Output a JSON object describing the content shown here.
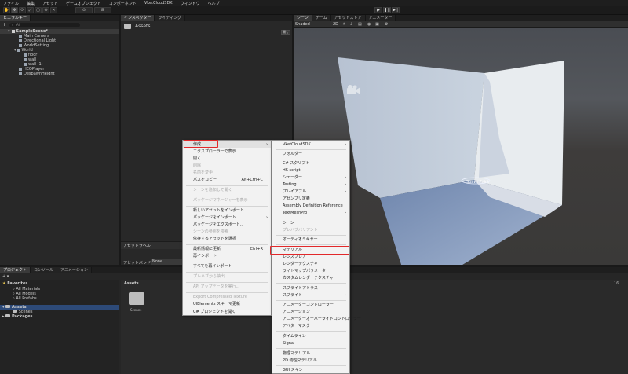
{
  "menubar": [
    "ファイル",
    "編集",
    "アセット",
    "ゲームオブジェクト",
    "コンポーネント",
    "VketCloudSDK",
    "ウィンドウ",
    "ヘルプ"
  ],
  "hierarchy": {
    "tab": "ヒエラルキー",
    "add": "+",
    "search_text": "All",
    "rows": [
      "SampleScene*",
      "Main Camera",
      "Directional Light",
      "WorldSetting",
      "World",
      "floor",
      "wall",
      "wall (1)",
      "HEOPlayer",
      "DespawnHeight"
    ]
  },
  "inspector": {
    "tabs": [
      "インスペクター",
      "ライティング"
    ],
    "header": "Assets",
    "open_btn": "開く",
    "asset_label_title": "アセットラベル",
    "asset_bundle_label": "アセットバンドル",
    "asset_bundle_value": "None"
  },
  "scene": {
    "tabs": [
      "シーン",
      "ゲーム",
      "アセットストア",
      "アニメーター"
    ],
    "shading": "Shaded",
    "mode2d": "2D",
    "spawn_label": "SpawnPoint"
  },
  "project": {
    "tabs": [
      "プロジェクト",
      "コンソール",
      "アニメーション"
    ],
    "favorites": "Favorites",
    "fav_items": [
      "All Materials",
      "All Models",
      "All Prefabs"
    ],
    "assets": "Assets",
    "scenes": "Scenes",
    "packages": "Packages",
    "assets_header": "Assets",
    "folder_label": "Scenes",
    "count": "16"
  },
  "context_menu": {
    "items": [
      {
        "label": "作成",
        "submenu": true,
        "highlight": true
      },
      {
        "label": "エクスプローラーで表示"
      },
      {
        "label": "開く"
      },
      {
        "label": "削除",
        "disabled": true
      },
      {
        "label": "名前を変更",
        "disabled": true
      },
      {
        "label": "パスをコピー",
        "shortcut": "Alt+Ctrl+C"
      },
      {
        "label": "シーンを追加して開く",
        "disabled": true
      },
      {
        "label": "パッケージマネージャーを表示",
        "disabled": true
      },
      {
        "label": "新しいアセットをインポート..."
      },
      {
        "label": "パッケージをインポート",
        "submenu": true
      },
      {
        "label": "パッケージをエクスポート..."
      },
      {
        "label": "シーンの参照を検索",
        "disabled": true
      },
      {
        "label": "依存するアセットを選択"
      },
      {
        "label": "最新情報に更新",
        "shortcut": "Ctrl+R"
      },
      {
        "label": "再インポート"
      },
      {
        "label": "すべてを再インポート"
      },
      {
        "label": "プレハブから抽出",
        "disabled": true
      },
      {
        "label": "API アップデータを実行...",
        "disabled": true
      },
      {
        "label": "Export Compressed Texture",
        "disabled": true
      },
      {
        "label": "UIElements スキーマ更新"
      },
      {
        "label": "C# プロジェクトを開く"
      }
    ]
  },
  "submenu": {
    "items": [
      {
        "label": "VketCloudSDK",
        "submenu": true
      },
      {
        "label": "フォルダー"
      },
      {
        "label": "C# スクリプト"
      },
      {
        "label": "HS script"
      },
      {
        "label": "シェーダー",
        "submenu": true
      },
      {
        "label": "Testing",
        "submenu": true
      },
      {
        "label": "プレイアブル",
        "submenu": true
      },
      {
        "label": "アセンブリ定義"
      },
      {
        "label": "Assembly Definition Reference"
      },
      {
        "label": "TextMeshPro",
        "submenu": true
      },
      {
        "label": "シーン"
      },
      {
        "label": "プレハブバリアント",
        "disabled": true
      },
      {
        "label": "オーディオミキサー"
      },
      {
        "label": "マテリアル",
        "highlight": true
      },
      {
        "label": "レンズフレア"
      },
      {
        "label": "レンダーテクスチャ"
      },
      {
        "label": "ライトマップパラメーター"
      },
      {
        "label": "カスタムレンダーテクスチャ"
      },
      {
        "label": "スプライトアトラス"
      },
      {
        "label": "スプライト",
        "submenu": true
      },
      {
        "label": "アニメーターコントローラー"
      },
      {
        "label": "アニメーション"
      },
      {
        "label": "アニメーターオーバーライドコントローラー"
      },
      {
        "label": "アバターマスク"
      },
      {
        "label": "タイムライン"
      },
      {
        "label": "Signal"
      },
      {
        "label": "物理マテリアル"
      },
      {
        "label": "2D 物理マテリアル"
      },
      {
        "label": "GUI スキン"
      }
    ]
  }
}
